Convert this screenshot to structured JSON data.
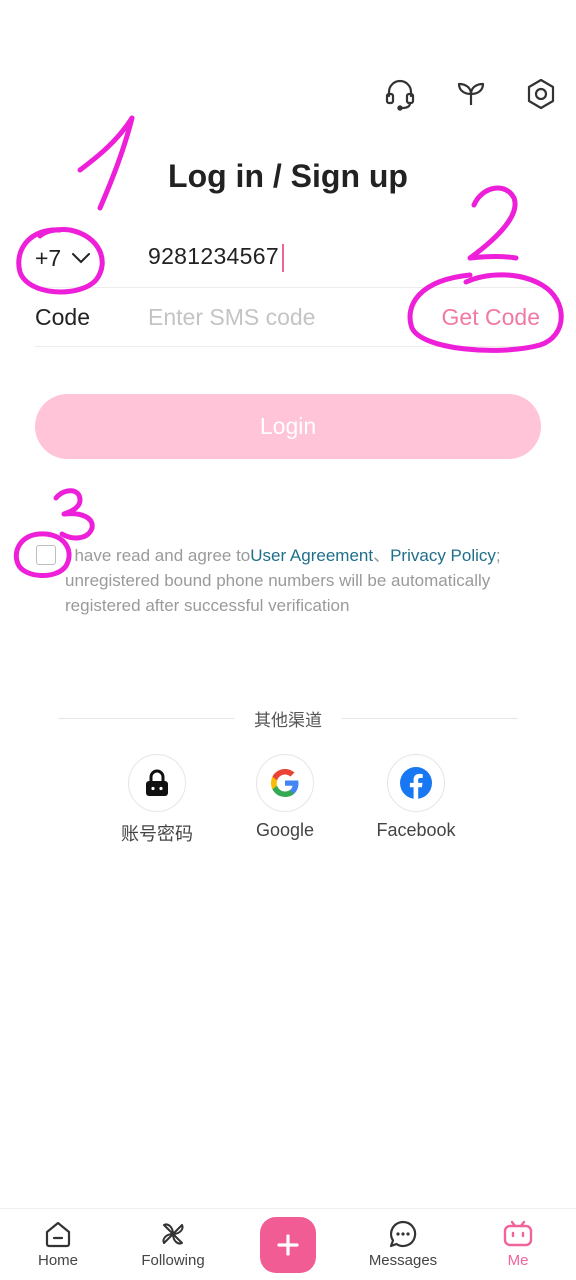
{
  "header": {
    "title": "Log in / Sign up",
    "icons": [
      "headset-icon",
      "sprout-icon",
      "settings-icon"
    ]
  },
  "phone": {
    "country_code": "+7",
    "value": "9281234567"
  },
  "code": {
    "label": "Code",
    "placeholder": "Enter SMS code",
    "get_code_label": "Get Code"
  },
  "login_button": "Login",
  "agreement": {
    "prefix": "I have read and agree to",
    "user_agreement": "User Agreement",
    "separator": "、",
    "privacy_policy": "Privacy Policy",
    "suffix": "; unregistered bound phone numbers will be automatically registered after successful verification",
    "checked": false
  },
  "other_channels": {
    "heading": "其他渠道",
    "items": [
      {
        "label": "账号密码",
        "icon": "lock-icon"
      },
      {
        "label": "Google",
        "icon": "google-icon"
      },
      {
        "label": "Facebook",
        "icon": "facebook-icon"
      }
    ]
  },
  "bottom_nav": {
    "items": [
      {
        "label": "Home",
        "icon": "home-icon"
      },
      {
        "label": "Following",
        "icon": "pinwheel-icon"
      },
      {
        "label": "Messages",
        "icon": "chat-icon"
      },
      {
        "label": "Me",
        "icon": "tv-icon"
      }
    ],
    "active": "Me"
  },
  "annotations": [
    "1",
    "2",
    "3"
  ],
  "colors": {
    "accent": "#f0639b",
    "login_button": "#ffc4d8",
    "link": "#1f6f8b",
    "annotation": "#ee1fd8"
  }
}
